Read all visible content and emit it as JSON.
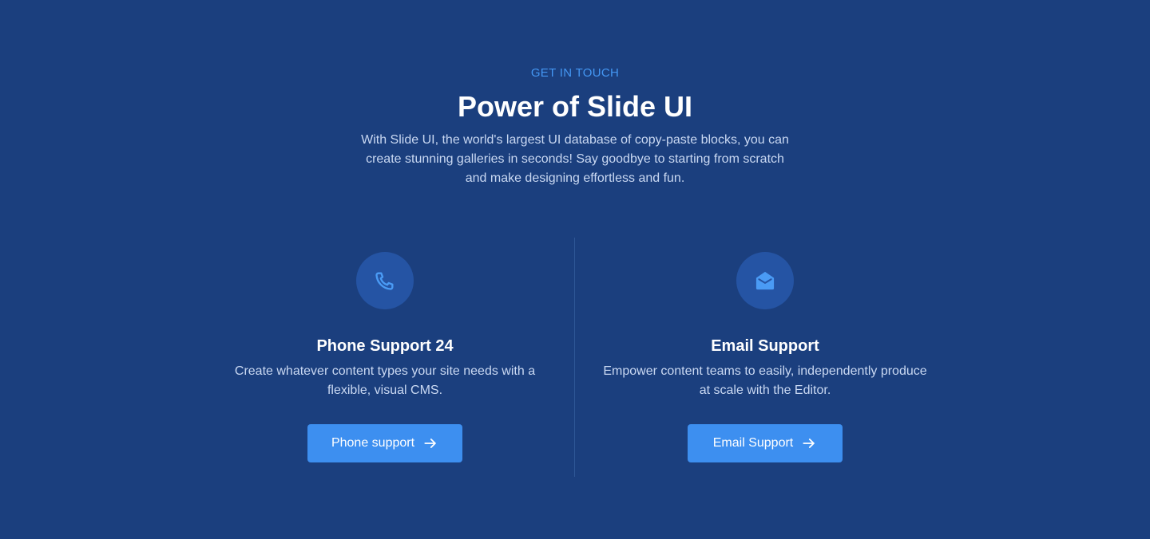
{
  "header": {
    "eyebrow": "GET IN TOUCH",
    "title": "Power of Slide UI",
    "subtitle": "With Slide UI, the world's largest UI database of copy-paste blocks, you can create stunning galleries in seconds! Say goodbye to starting from scratch and make designing effortless and fun."
  },
  "cards": [
    {
      "icon": "phone-icon",
      "title": "Phone Support 24",
      "text": "Create whatever content types your site needs with a flexible, visual CMS.",
      "button_label": "Phone support",
      "button_icon": "arrow-right-icon"
    },
    {
      "icon": "envelope-open-icon",
      "title": "Email Support",
      "text": "Empower content teams to easily, independently produce at scale with the Editor.",
      "button_label": "Email Support",
      "button_icon": "arrow-right-icon"
    }
  ],
  "colors": {
    "background": "#1b3f7e",
    "accent": "#4497f3",
    "button": "#3d8ff0",
    "icon_circle": "#2554a4",
    "body_text": "#c9d8f2"
  }
}
